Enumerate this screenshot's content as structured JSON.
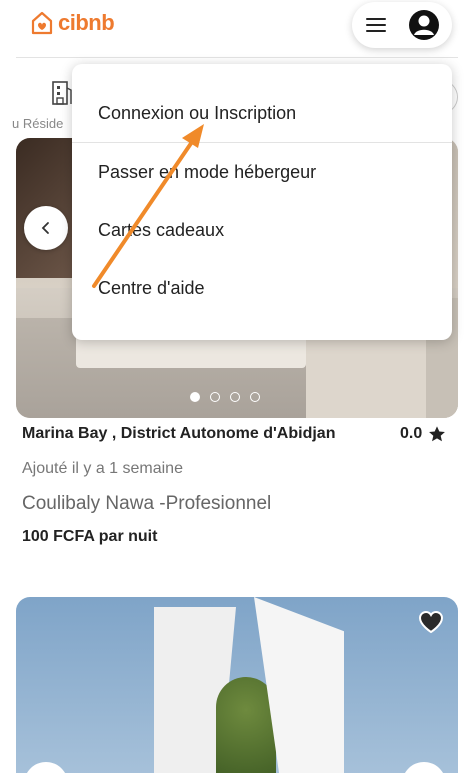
{
  "header": {
    "logo_text": "cibnb",
    "brand_color": "#ee7a2f"
  },
  "categories": {
    "visible_label": "u Réside",
    "icon": "building-icon"
  },
  "menu": {
    "items": [
      {
        "label": "Connexion ou Inscription"
      },
      {
        "label": "Passer en mode hébergeur"
      },
      {
        "label": "Cartes cadeaux"
      },
      {
        "label": "Centre d'aide"
      }
    ]
  },
  "listing": {
    "title": "Marina Bay , District Autonome d'Abidjan",
    "rating": "0.0",
    "added": "Ajouté il y a 1 semaine",
    "host": "Coulibaly Nawa -Profesionnel",
    "price": "100 FCFA par nuit",
    "carousel_dots": 4,
    "active_dot": 0
  },
  "annotation": {
    "color": "#f08a2a"
  }
}
